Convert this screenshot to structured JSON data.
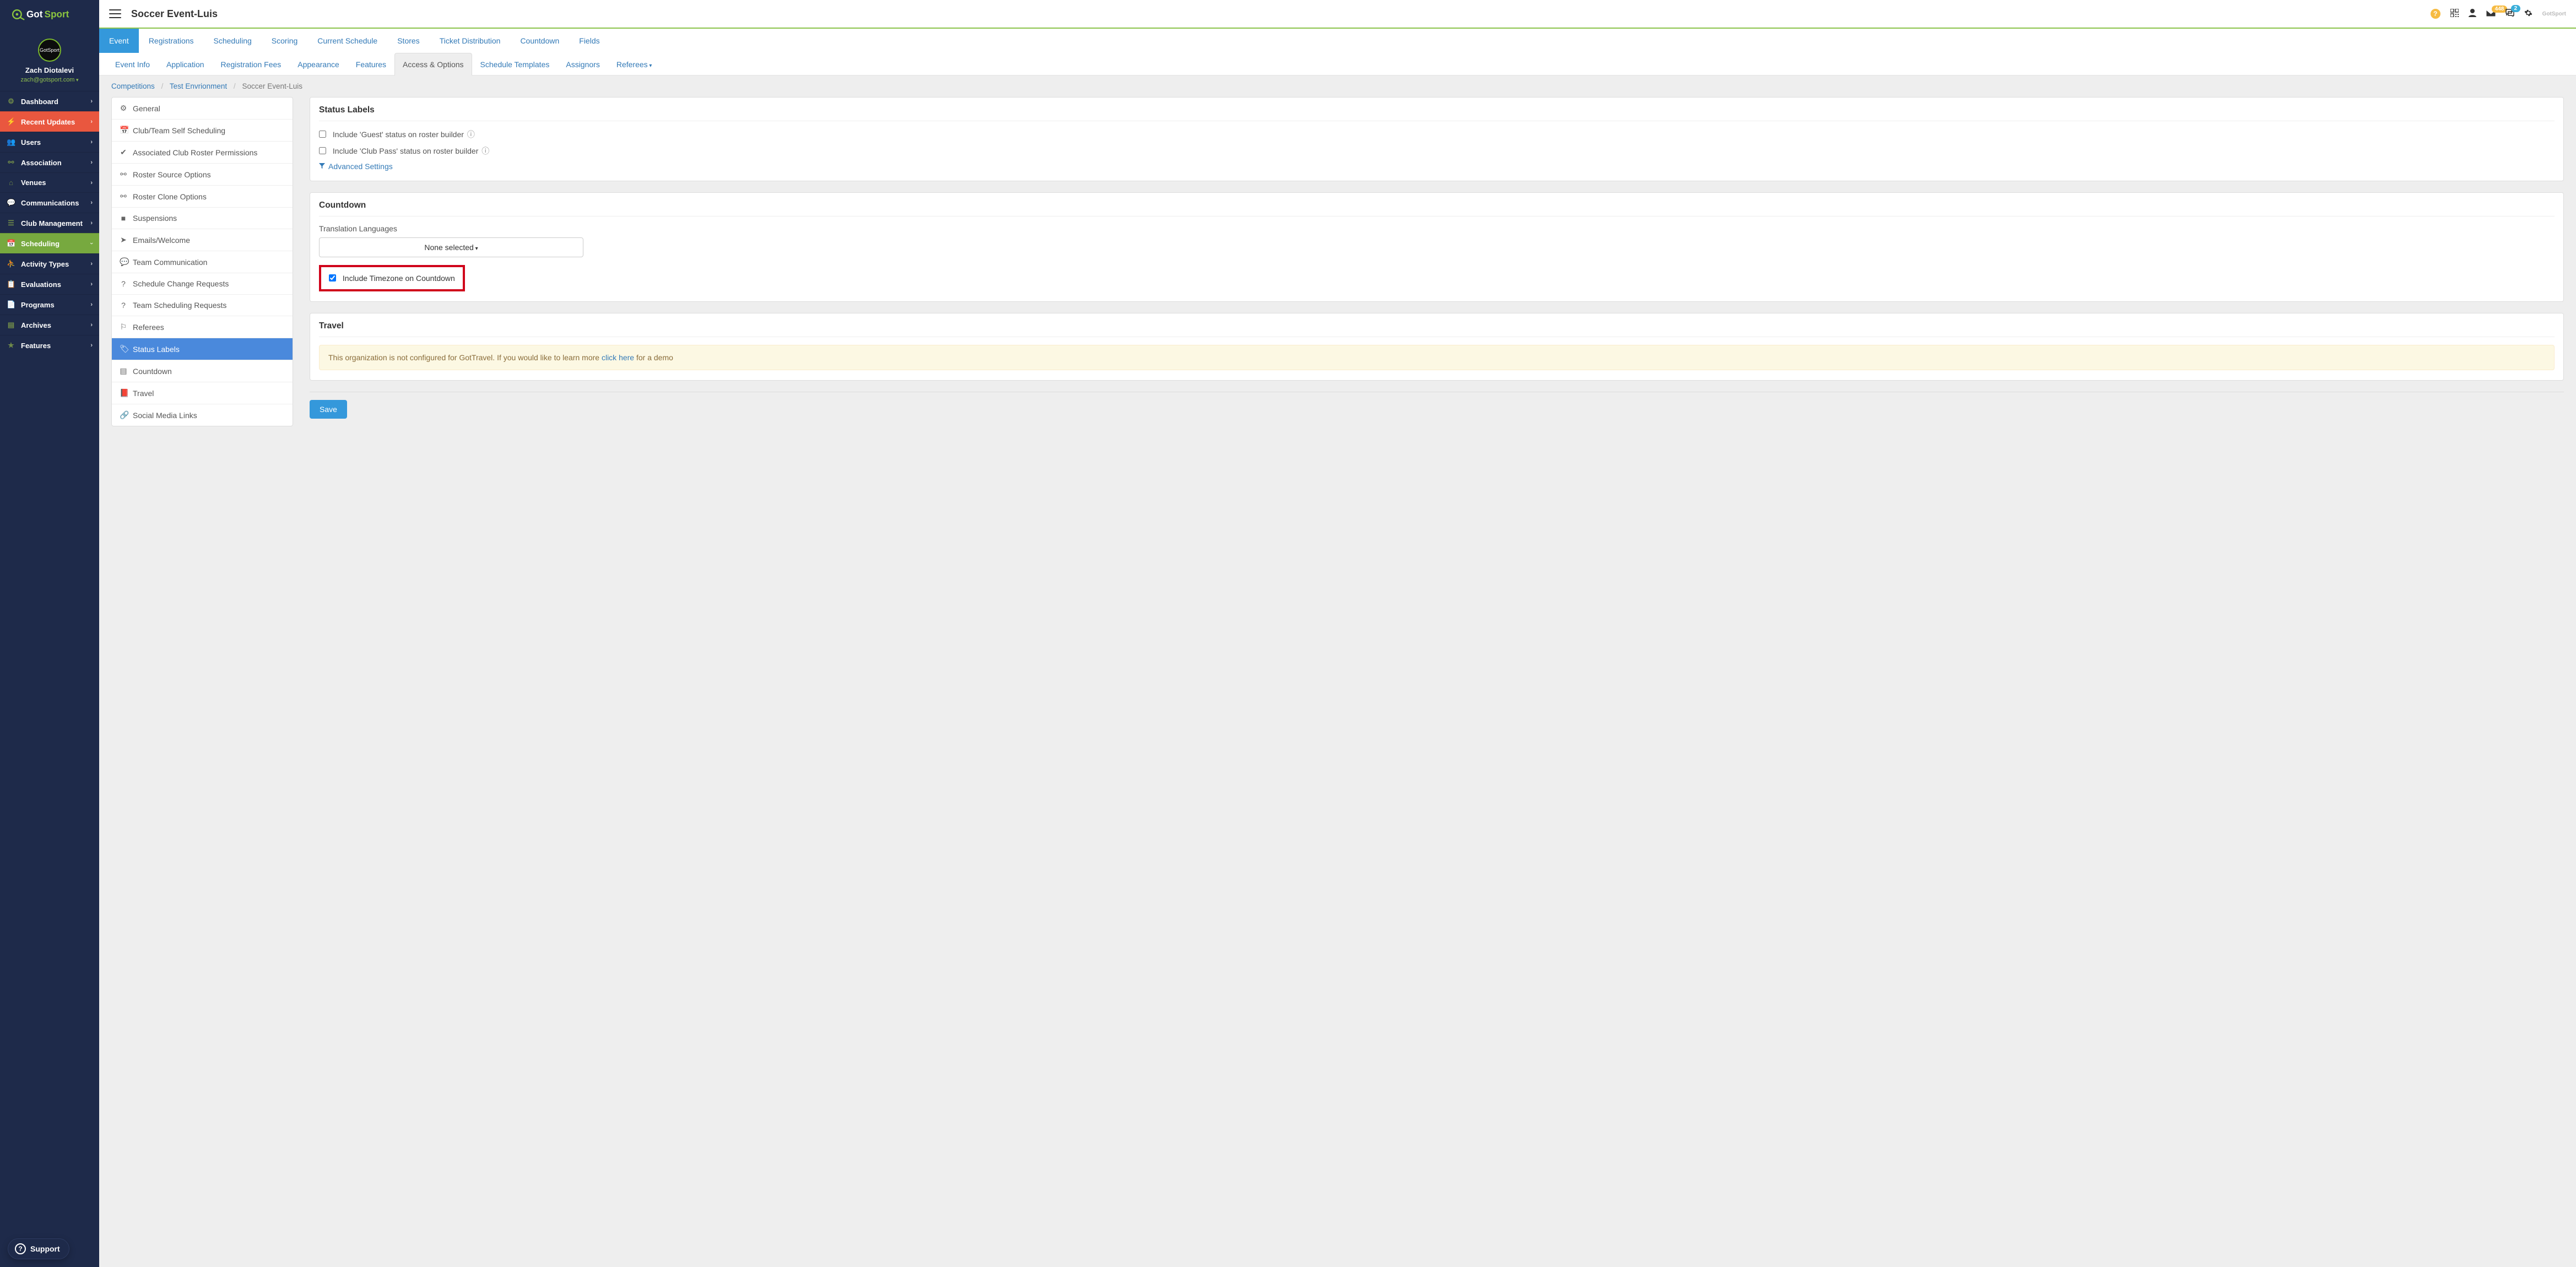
{
  "brand": "GotSport",
  "user": {
    "name": "Zach Diotalevi",
    "email": "zach@gotsport.com"
  },
  "sidebar": [
    {
      "icon": "tachometer",
      "label": "Dashboard",
      "glyph": "⚙"
    },
    {
      "icon": "bolt",
      "label": "Recent Updates",
      "class": "recent",
      "glyph": "⚡"
    },
    {
      "icon": "users",
      "label": "Users",
      "glyph": "👥"
    },
    {
      "icon": "sitemap",
      "label": "Association",
      "glyph": "⚯"
    },
    {
      "icon": "home",
      "label": "Venues",
      "glyph": "⌂"
    },
    {
      "icon": "comments",
      "label": "Communications",
      "glyph": "💬"
    },
    {
      "icon": "th-list",
      "label": "Club Management",
      "glyph": "☰"
    },
    {
      "icon": "calendar",
      "label": "Scheduling",
      "class": "scheduling",
      "glyph": "📅"
    },
    {
      "icon": "running",
      "label": "Activity Types",
      "glyph": "⛹"
    },
    {
      "icon": "clipboard",
      "label": "Evaluations",
      "glyph": "📋"
    },
    {
      "icon": "file",
      "label": "Programs",
      "glyph": "📄"
    },
    {
      "icon": "archive",
      "label": "Archives",
      "glyph": "▤"
    },
    {
      "icon": "star",
      "label": "Features",
      "glyph": "★"
    }
  ],
  "support_label": "Support",
  "topbar": {
    "title": "Soccer Event-Luis",
    "mail_badge": "448",
    "chat_badge": "2"
  },
  "tabs_primary": [
    {
      "label": "Event",
      "active": true
    },
    {
      "label": "Registrations"
    },
    {
      "label": "Scheduling"
    },
    {
      "label": "Scoring"
    },
    {
      "label": "Current Schedule"
    },
    {
      "label": "Stores"
    },
    {
      "label": "Ticket Distribution"
    },
    {
      "label": "Countdown"
    },
    {
      "label": "Fields"
    }
  ],
  "tabs_secondary": [
    {
      "label": "Event Info"
    },
    {
      "label": "Application"
    },
    {
      "label": "Registration Fees"
    },
    {
      "label": "Appearance"
    },
    {
      "label": "Features"
    },
    {
      "label": "Access & Options",
      "active": true
    },
    {
      "label": "Schedule Templates"
    },
    {
      "label": "Assignors"
    },
    {
      "label": "Referees",
      "caret": true
    }
  ],
  "breadcrumb": {
    "a": "Competitions",
    "b": "Test Envrionment",
    "c": "Soccer Event-Luis"
  },
  "options": [
    {
      "glyph": "⚙",
      "label": "General"
    },
    {
      "glyph": "📅",
      "label": "Club/Team Self Scheduling"
    },
    {
      "glyph": "✔",
      "label": "Associated Club Roster Permissions"
    },
    {
      "glyph": "⚯",
      "label": "Roster Source Options"
    },
    {
      "glyph": "⚯",
      "label": "Roster Clone Options"
    },
    {
      "glyph": "■",
      "label": "Suspensions"
    },
    {
      "glyph": "➤",
      "label": "Emails/Welcome"
    },
    {
      "glyph": "💬",
      "label": "Team Communication"
    },
    {
      "glyph": "?",
      "label": "Schedule Change Requests"
    },
    {
      "glyph": "?",
      "label": "Team Scheduling Requests"
    },
    {
      "glyph": "⚐",
      "label": "Referees"
    },
    {
      "glyph": "🏷",
      "label": "Status Labels",
      "active": true
    },
    {
      "glyph": "▤",
      "label": "Countdown"
    },
    {
      "glyph": "📕",
      "label": "Travel"
    },
    {
      "glyph": "🔗",
      "label": "Social Media Links"
    }
  ],
  "panels": {
    "status": {
      "title": "Status Labels",
      "guest": "Include 'Guest' status on roster builder",
      "clubpass": "Include 'Club Pass' status on roster builder",
      "advanced": "Advanced Settings"
    },
    "countdown": {
      "title": "Countdown",
      "lang_label": "Translation Languages",
      "lang_value": "None selected",
      "include_tz": "Include Timezone on Countdown"
    },
    "travel": {
      "title": "Travel",
      "msg_pre": "This organization is not configured for GotTravel. If you would like to learn more ",
      "link": "click here",
      "msg_post": " for a demo"
    },
    "save": "Save"
  }
}
